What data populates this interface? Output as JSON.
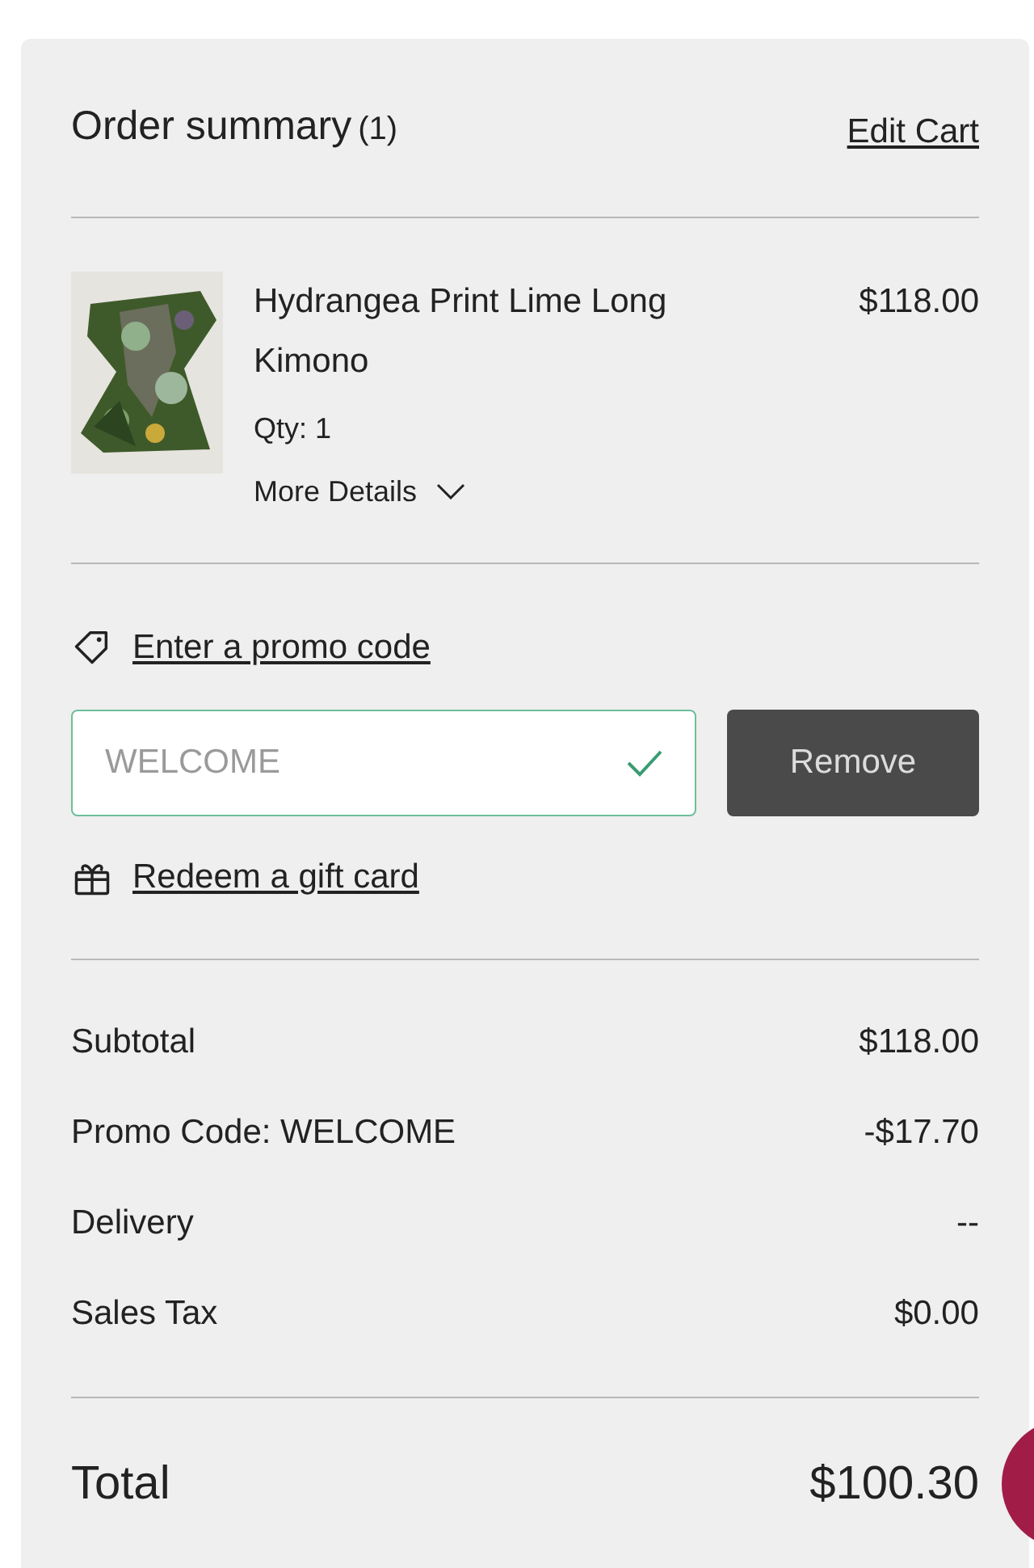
{
  "header": {
    "title": "Order summary",
    "count": "(1)",
    "edit_link": "Edit Cart"
  },
  "item": {
    "kind": "picture",
    "name": "Hydrangea Print Lime Long Kimono",
    "price": "$118.00",
    "quantity": "Qty: 1",
    "details_toggle": "More Details",
    "expanded": false
  },
  "promo": {
    "link": "Enter a promo code",
    "field": {
      "value": "WELCOME",
      "valid": true
    },
    "button": "Remove"
  },
  "gift_card": {
    "link": "Redeem a gift card"
  },
  "totals": [
    {
      "label": "Subtotal",
      "value": "$118.00"
    },
    {
      "label": "Promo Code: WELCOME",
      "value": "-$17.70"
    },
    {
      "label": "Delivery",
      "value": "--"
    },
    {
      "label": "Sales Tax",
      "value": "$0.00"
    }
  ],
  "total": {
    "label": "Total",
    "value": "$100.30"
  }
}
